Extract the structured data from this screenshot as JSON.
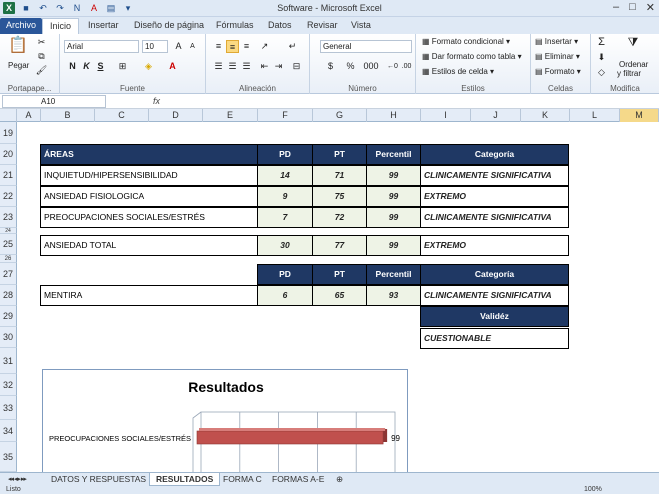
{
  "window": {
    "title": "Software  -  Microsoft Excel"
  },
  "tabs": [
    "Archivo",
    "Inicio",
    "Insertar",
    "Diseño de página",
    "Fórmulas",
    "Datos",
    "Revisar",
    "Vista"
  ],
  "ribbon": {
    "clipboard": {
      "paste": "Pegar",
      "label": "Portapape..."
    },
    "font": {
      "name": "Arial",
      "size": "10",
      "bold": "N",
      "italic": "K",
      "underline": "S",
      "label": "Fuente"
    },
    "alignment": {
      "label": "Alineación"
    },
    "number": {
      "format": "General",
      "currency": "$",
      "percent": "%",
      "thousands": "000",
      "label": "Número"
    },
    "styles": {
      "conditional": "Formato condicional",
      "as_table": "Dar formato como tabla",
      "cell_styles": "Estilos de celda",
      "label": "Estilos"
    },
    "cells": {
      "insert": "Insertar",
      "delete": "Eliminar",
      "format": "Formato",
      "label": "Celdas"
    },
    "editing": {
      "sort": "Ordenar",
      "filter": "y filtrar",
      "label": "Modifica"
    }
  },
  "formula_bar": {
    "name_box": "A10",
    "fx": "fx"
  },
  "columns": [
    "A",
    "B",
    "C",
    "D",
    "E",
    "F",
    "G",
    "H",
    "I",
    "J",
    "K",
    "L",
    "M"
  ],
  "rows": [
    "19",
    "20",
    "21",
    "22",
    "23",
    "24",
    "25",
    "26",
    "27",
    "28",
    "29",
    "30",
    "31",
    "32",
    "33",
    "34",
    "35"
  ],
  "table1": {
    "headers": {
      "area": "ÁREAS",
      "pd": "PD",
      "pt": "PT",
      "percentil": "Percentil",
      "categoria": "Categoría"
    },
    "rows": [
      {
        "area": "INQUIETUD/HIPERSENSIBILIDAD",
        "pd": "14",
        "pt": "71",
        "percentil": "99",
        "categoria": "CLINICAMENTE SIGNIFICATIVA"
      },
      {
        "area": "ANSIEDAD FISIOLOGICA",
        "pd": "9",
        "pt": "75",
        "percentil": "99",
        "categoria": "EXTREMO"
      },
      {
        "area": "PREOCUPACIONES SOCIALES/ESTRÉS",
        "pd": "7",
        "pt": "72",
        "percentil": "99",
        "categoria": "CLINICAMENTE SIGNIFICATIVA"
      }
    ],
    "total": {
      "area": "ANSIEDAD TOTAL",
      "pd": "30",
      "pt": "77",
      "percentil": "99",
      "categoria": "EXTREMO"
    }
  },
  "table2": {
    "headers": {
      "pd": "PD",
      "pt": "PT",
      "percentil": "Percentil",
      "categoria": "Categoría"
    },
    "row": {
      "area": "MENTIRA",
      "pd": "6",
      "pt": "65",
      "percentil": "93",
      "categoria": "CLINICAMENTE SIGNIFICATIVA"
    },
    "validez_header": "Validéz",
    "validez": "CUESTIONABLE"
  },
  "chart_data": {
    "type": "bar",
    "title": "Resultados",
    "categories": [
      "PREOCUPACIONES SOCIALES/ESTRÉS"
    ],
    "values": [
      99
    ],
    "data_labels": [
      "99"
    ],
    "bar_color": "#c0504d",
    "xlim": [
      0,
      100
    ]
  },
  "sheet_tabs": [
    "DATOS Y RESPUESTAS",
    "RESULTADOS",
    "FORMA C",
    "FORMAS A-E"
  ],
  "active_sheet": "RESULTADOS",
  "status": {
    "ready": "Listo",
    "zoom": "100%"
  },
  "colors": {
    "header_fill": "#1f3864",
    "number_fill": "#eef3e6",
    "file_tab": "#2a5699"
  }
}
